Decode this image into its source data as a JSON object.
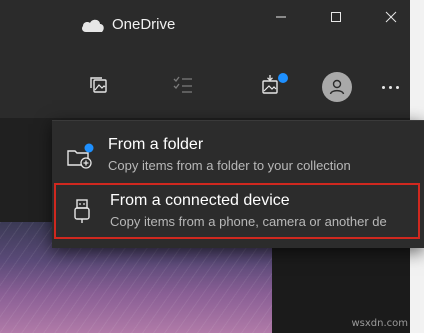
{
  "app": {
    "title": "OneDrive"
  },
  "window_controls": [
    "minimize",
    "maximize",
    "close"
  ],
  "toolbar": {
    "buttons": [
      {
        "icon": "photos-icon"
      },
      {
        "icon": "checklist-icon"
      },
      {
        "icon": "import-icon",
        "badge": true
      },
      {
        "icon": "account-icon"
      },
      {
        "icon": "more-icon"
      }
    ]
  },
  "menu": {
    "items": [
      {
        "icon": "folder-add-icon",
        "title": "From a folder",
        "description": "Copy items from a folder to your collection"
      },
      {
        "icon": "usb-device-icon",
        "title": "From a connected device",
        "description": "Copy items from a phone, camera or another de"
      }
    ]
  },
  "watermark": "wsxdn.com",
  "colors": {
    "accent": "#1e90ff",
    "highlight_border": "#d0281f"
  }
}
